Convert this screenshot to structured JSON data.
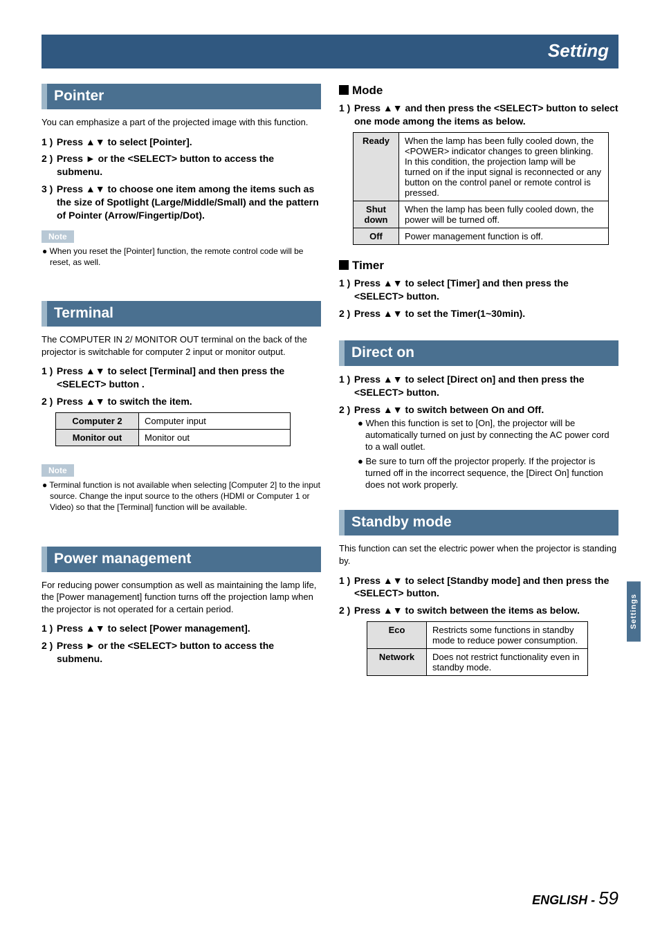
{
  "topHeader": "Setting",
  "sideTab": "Settings",
  "pageLang": "ENGLISH",
  "pageDash": " - ",
  "pageNum": "59",
  "left": {
    "pointer": {
      "title": "Pointer",
      "intro": "You can emphasize a part of the projected image with this function.",
      "step1": "Press ▲▼ to select [Pointer].",
      "step2": "Press ► or the <SELECT> button to access the submenu.",
      "step3": "Press ▲▼ to choose one item among the items such as the size of Spotlight (Large/Middle/Small) and the pattern of Pointer (Arrow/Fingertip/Dot).",
      "noteLabel": "Note",
      "note1": "When you reset the [Pointer] function, the remote control code will be reset, as well."
    },
    "terminal": {
      "title": "Terminal",
      "intro": "The COMPUTER IN 2/ MONITOR OUT terminal on the back of the projector is switchable for computer 2 input or monitor output.",
      "step1": "Press ▲▼ to select [Terminal] and then press the <SELECT> button .",
      "step2": "Press ▲▼ to switch the item.",
      "tbl": {
        "r1h": "Computer 2",
        "r1v": "Computer input",
        "r2h": "Monitor out",
        "r2v": "Monitor out"
      },
      "noteLabel": "Note",
      "note1": "Terminal function is not available when selecting [Computer 2] to the input source. Change the input source to the others (HDMI or Computer 1 or Video) so that the [Terminal] function will be available."
    },
    "power": {
      "title": "Power management",
      "intro": "For reducing power consumption as well as maintaining the lamp life, the [Power management] function turns off the projection lamp when the projector is not operated for a certain period.",
      "step1": "Press ▲▼ to select [Power management].",
      "step2": "Press ► or the <SELECT> button to access the submenu."
    }
  },
  "right": {
    "mode": {
      "h": "Mode",
      "step1": "Press ▲▼ and then press the <SELECT> button to select one mode among the items as below.",
      "tbl": {
        "r1h": "Ready",
        "r1v": "When the lamp has been fully cooled down, the <POWER> indicator changes to green blinking. In this condition, the projection lamp will be turned on if the input signal is reconnected or any button on the control panel or remote control is pressed.",
        "r2h": "Shut down",
        "r2v": "When the lamp has been fully cooled down, the power will be turned off.",
        "r3h": "Off",
        "r3v": "Power management function is off."
      }
    },
    "timer": {
      "h": "Timer",
      "step1": "Press ▲▼ to select [Timer] and then press the <SELECT> button.",
      "step2": "Press ▲▼ to set the Timer(1~30min)."
    },
    "direct": {
      "title": "Direct on",
      "step1": "Press ▲▼ to select [Direct on] and then press the <SELECT> button.",
      "step2": "Press ▲▼ to switch between On and Off.",
      "b1": "When this function is set to [On], the projector will be automatically turned on just by connecting the AC power cord to a wall outlet.",
      "b2": "Be sure to turn off the projector properly. If the projector is turned off in the incorrect sequence, the [Direct On] function does not work properly."
    },
    "standby": {
      "title": "Standby mode",
      "intro": "This function can set the electric power when the projector is standing by.",
      "step1": "Press ▲▼ to select [Standby mode] and then press the <SELECT> button.",
      "step2": "Press ▲▼ to switch between the items as below.",
      "tbl": {
        "r1h": "Eco",
        "r1v": "Restricts some functions in standby mode to reduce power consumption.",
        "r2h": "Network",
        "r2v": "Does not restrict functionality even in standby mode."
      }
    }
  }
}
